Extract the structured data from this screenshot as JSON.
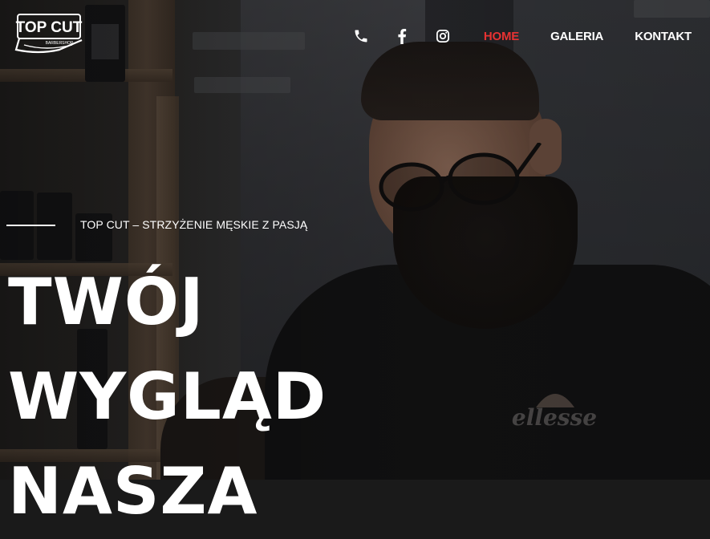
{
  "brand": {
    "logo_text": "TOP CUT",
    "logo_subtext": "BARBERSHOP"
  },
  "nav": {
    "icons": [
      "phone-icon",
      "facebook-icon",
      "instagram-icon"
    ],
    "links": [
      {
        "label": "HOME",
        "active": true
      },
      {
        "label": "GALERIA",
        "active": false
      },
      {
        "label": "KONTAKT",
        "active": false
      }
    ],
    "active_color": "#e63232"
  },
  "hero": {
    "tagline": "TOP CUT – STRZYŻENIE MĘSKIE Z PASJĄ",
    "headline_lines": [
      "TWÓJ",
      "WYGLĄD",
      "NASZA"
    ]
  },
  "shirt_logo": "ellesse"
}
